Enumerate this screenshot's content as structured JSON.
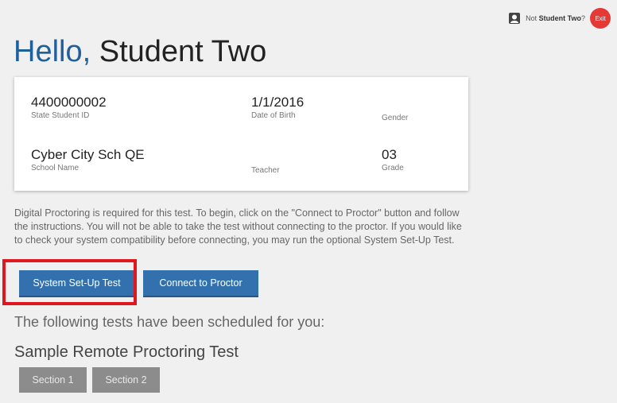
{
  "account": {
    "not_prefix": "Not",
    "user_name": "Student Two",
    "not_suffix": "?",
    "exit_label": "Exit"
  },
  "greeting": {
    "hello": "Hello,",
    "name": "Student Two"
  },
  "student_info": {
    "state_student_id": {
      "value": "4400000002",
      "label": "State Student ID"
    },
    "date_of_birth": {
      "value": "1/1/2016",
      "label": "Date of Birth"
    },
    "gender": {
      "value": "",
      "label": "Gender"
    },
    "school_name": {
      "value": "Cyber City Sch QE",
      "label": "School Name"
    },
    "teacher": {
      "value": "",
      "label": "Teacher"
    },
    "grade": {
      "value": "03",
      "label": "Grade"
    }
  },
  "instructions": "Digital Proctoring is required for this test. To begin, click on the \"Connect to Proctor\" button and follow the instructions. You will not be able to take the test without connecting to the proctor. If you would like to check your system compatibility before connecting, you may run the optional System Set-Up Test.",
  "actions": {
    "setup_label": "System Set-Up Test",
    "connect_label": "Connect to Proctor"
  },
  "scheduled_text": "The following tests have been scheduled for you:",
  "test": {
    "title": "Sample Remote Proctoring Test",
    "sections": [
      "Section 1",
      "Section 2"
    ]
  },
  "colors": {
    "accent_blue": "#3271ad",
    "hello_blue": "#1f5f9a",
    "exit_red": "#e53935",
    "highlight_red": "#e0171e",
    "section_gray": "#8c8c8c"
  },
  "icons": {
    "user": "user-badge-icon"
  }
}
